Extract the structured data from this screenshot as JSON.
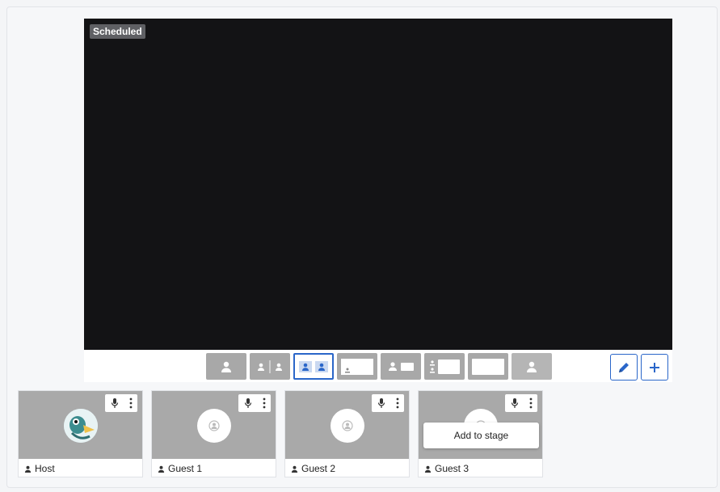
{
  "stage": {
    "status": "Scheduled"
  },
  "layouts": [
    {
      "name": "layout-single"
    },
    {
      "name": "layout-split"
    },
    {
      "name": "layout-group"
    },
    {
      "name": "layout-pip"
    },
    {
      "name": "layout-side-by-side"
    },
    {
      "name": "layout-sidebar"
    },
    {
      "name": "layout-fullscreen-screen"
    },
    {
      "name": "layout-solo-person"
    }
  ],
  "actions": {
    "edit_icon": "pencil-icon",
    "add_icon": "plus-icon"
  },
  "participants": [
    {
      "name": "Host",
      "avatar": "duck"
    },
    {
      "name": "Guest 1",
      "avatar": "default"
    },
    {
      "name": "Guest 2",
      "avatar": "default"
    },
    {
      "name": "Guest 3",
      "avatar": "default",
      "tooltip": "Add to stage"
    }
  ],
  "colors": {
    "accent": "#2a66c9",
    "stage_bg": "#131315",
    "tile_bg": "#a9a9a9"
  }
}
